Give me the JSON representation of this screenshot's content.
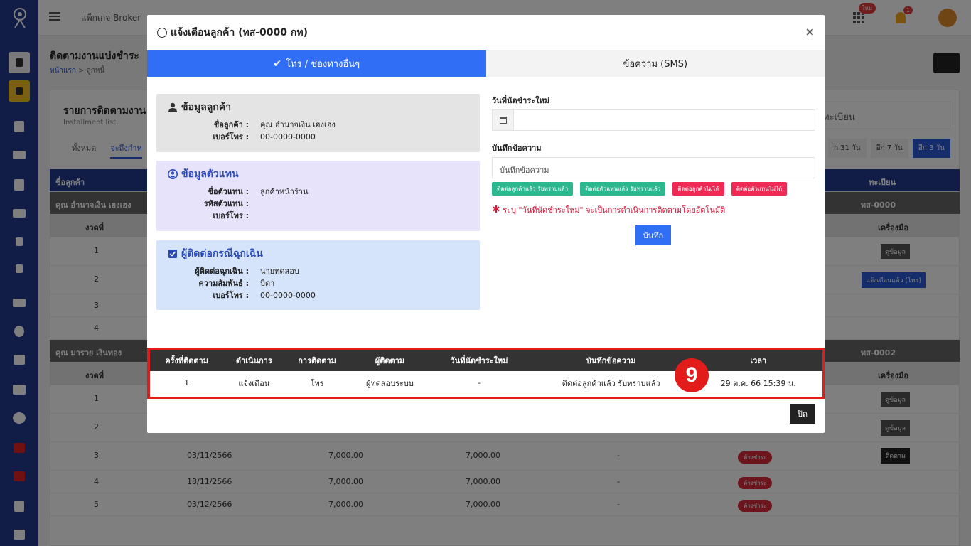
{
  "topbar": {
    "package_label": "แพ็กเกจ Broker",
    "new_badge": "ใหม่",
    "bell_count": "1"
  },
  "page": {
    "title": "ติดตามงานแบ่งชำระ",
    "breadcrumb_home": "หน้าแรก",
    "breadcrumb_current": "ลูกหนี้"
  },
  "card": {
    "title": "รายการติดตามงาน",
    "subtitle": "Installment list.",
    "tab_all": "ทั้งหมด",
    "tab_due": "จะถึงกำห",
    "search_text": "ทะเบียน",
    "filter_31": "ก 31 วัน",
    "filter_7": "อีก 7 วัน",
    "filter_3": "อีก 3 วัน"
  },
  "bg_table": {
    "col_customer": "ชื่อลูกค้า",
    "col_reg": "ทะเบียน",
    "col_installment": "งวดที่",
    "col_tools": "เครื่องมือ",
    "group1_name": "คุณ อำนาจเงิน เฮงเฮง",
    "group1_reg": "ทส-0000",
    "group2_name": "คุณ มารวย เงินทอง",
    "group2_reg": "ทส-0002",
    "btn_view": "ดูข้อมูล",
    "btn_notified": "แจ้งเตือนแล้ว (โทร)",
    "btn_follow": "ติดตาม",
    "overdue": "ค้างชำระ",
    "g1_rows": [
      "1",
      "2",
      "3",
      "4"
    ],
    "g2_rows": [
      {
        "n": "1"
      },
      {
        "n": "2"
      },
      {
        "n": "3",
        "date": "03/11/2566",
        "a": "7,000.00",
        "b": "7,000.00",
        "c": "-"
      },
      {
        "n": "4",
        "date": "18/11/2566",
        "a": "7,000.00",
        "b": "7,000.00",
        "c": "-"
      },
      {
        "n": "5",
        "date": "03/12/2566",
        "a": "7,000.00",
        "b": "7,000.00",
        "c": "-"
      }
    ]
  },
  "modal": {
    "title": "แจ้งเตือนลูกค้า (ทส-0000 กท)",
    "close_x": "×",
    "tab_call": "โทร / ช่องทางอื่นๆ",
    "tab_sms": "ข้อความ (SMS)",
    "customer": {
      "title": "ข้อมูลลูกค้า",
      "name_label": "ชื่อลูกค้า :",
      "name": "คุณ อำนาจเงิน เฮงเฮง",
      "phone_label": "เบอร์โทร :",
      "phone": "00-0000-0000"
    },
    "agent": {
      "title": "ข้อมูลตัวแทน",
      "name_label": "ชื่อตัวแทน :",
      "name": "ลูกค้าหน้าร้าน",
      "code_label": "รหัสตัวแทน :",
      "code": "",
      "phone_label": "เบอร์โทร :",
      "phone": ""
    },
    "emergency": {
      "title": "ผู้ติดต่อกรณีฉุกเฉิน",
      "contact_label": "ผู้ติดต่อฉุกเฉิน :",
      "contact": "นายทดสอบ",
      "rel_label": "ความสัมพันธ์ :",
      "rel": "บิดา",
      "phone_label": "เบอร์โทร :",
      "phone": "00-0000-0000"
    },
    "new_date_label": "วันที่นัดชำระใหม่",
    "note_label": "บันทึกข้อความ",
    "note_placeholder": "บันทึกข้อความ",
    "quick": [
      "ติดต่อลูกค้าแล้ว รับทราบแล้ว",
      "ติดต่อตัวแทนแล้ว รับทราบแล้ว",
      "ติดต่อลูกค้าไม่ได้",
      "ติดต่อตัวแทนไม่ได้"
    ],
    "warning": "ระบุ \"วันที่นัดชำระใหม่\" จะเป็นการดำเนินการติดตามโดยอัตโนมัติ",
    "save": "บันทึก",
    "history": {
      "headers": [
        "ครั้งที่ติดตาม",
        "ดำเนินการ",
        "การติดตาม",
        "ผู้ติดตาม",
        "วันที่นัดชำระใหม่",
        "บันทึกข้อความ",
        "เวลา"
      ],
      "rows": [
        [
          "1",
          "แจ้งเตือน",
          "โทร",
          "ผู้ทดสอบระบบ",
          "-",
          "ติดต่อลูกค้าแล้ว รับทราบแล้ว",
          "29 ต.ค. 66 15:39 น."
        ]
      ]
    },
    "step_number": "9",
    "close": "ปิด"
  },
  "colors": {
    "primary": "#2f6ef5",
    "sidebar": "#233a8c",
    "highlight": "#e21b1b"
  }
}
